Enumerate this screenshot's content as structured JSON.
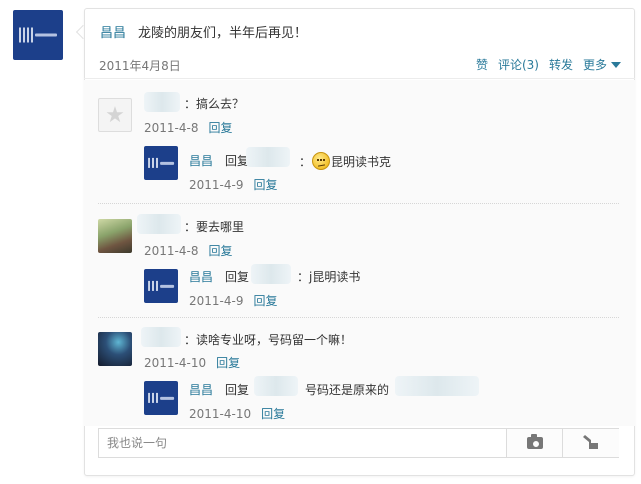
{
  "post": {
    "author": "昌昌",
    "text": "龙陵的朋友们，半年后再见！",
    "date": "2011年4月8日",
    "actions": {
      "like": "赞",
      "comment": "评论(3)",
      "repost": "转发",
      "more": "更多"
    }
  },
  "comments": [
    {
      "text": "：搞么去？",
      "date": "2011-4-8",
      "reply_label": "回复",
      "reply": {
        "author": "昌昌",
        "prefix": "回复",
        "sep": "：",
        "text": "昆明读书克",
        "date": "2011-4-9",
        "reply_label": "回复"
      }
    },
    {
      "text": "：要去哪里",
      "date": "2011-4-8",
      "reply_label": "回复",
      "reply": {
        "author": "昌昌",
        "prefix": "回复",
        "text": "：j昆明读书",
        "date": "2011-4-9",
        "reply_label": "回复"
      }
    },
    {
      "text": "：读啥专业呀，号码留一个嘛！",
      "date": "2011-4-10",
      "reply_label": "回复",
      "reply": {
        "author": "昌昌",
        "prefix": "回复",
        "text": "号码还是原来的",
        "date": "2011-4-10",
        "reply_label": "回复"
      }
    }
  ],
  "composer": {
    "placeholder": "我也说一句"
  },
  "colors": {
    "link": "#2a7a9a",
    "avatar_blue": "#1c3f8a"
  },
  "icons": {
    "default_avatar": "star-avatar-icon",
    "emoji": "confused-emoji-icon",
    "photo": "camera-icon",
    "like": "thumb-pointer-icon",
    "more": "triangle-down-icon"
  }
}
